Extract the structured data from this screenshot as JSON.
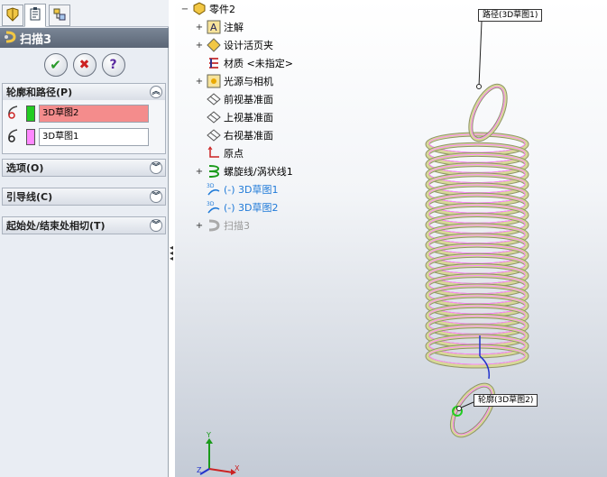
{
  "property_manager": {
    "title": "扫描3",
    "tabs": [
      "feature-manager-icon",
      "property-manager-icon",
      "configuration-manager-icon"
    ],
    "buttons": {
      "ok": "✔",
      "cancel": "✖",
      "help": "?"
    },
    "groups": {
      "profile_path": {
        "label": "轮廓和路径(P)",
        "profile_value": "3D草图2",
        "path_value": "3D草图1",
        "profile_color": "#22cc22",
        "path_color": "#ff88ff"
      },
      "options": {
        "label": "选项(O)"
      },
      "guide_curves": {
        "label": "引导线(C)"
      },
      "start_end_tangency": {
        "label": "起始处/结束处相切(T)"
      }
    }
  },
  "tree": {
    "root": "零件2",
    "items": [
      {
        "label": "注解",
        "expandable": true
      },
      {
        "label": "设计活页夹",
        "expandable": true
      },
      {
        "label": "材质 <未指定>",
        "expandable": false
      },
      {
        "label": "光源与相机",
        "expandable": true
      },
      {
        "label": "前视基准面",
        "expandable": false
      },
      {
        "label": "上视基准面",
        "expandable": false
      },
      {
        "label": "右视基准面",
        "expandable": false
      },
      {
        "label": "原点",
        "expandable": false
      },
      {
        "label": "螺旋线/涡状线1",
        "expandable": true
      },
      {
        "label": "(-) 3D草图1",
        "expandable": false
      },
      {
        "label": "(-) 3D草图2",
        "expandable": false
      },
      {
        "label": "扫描3",
        "expandable": true
      }
    ]
  },
  "viewport": {
    "callout_path": "路径(3D草图1)",
    "callout_profile": "轮廓(3D草图2)",
    "triad_axes": {
      "x": "X",
      "y": "Y",
      "z": "Z"
    },
    "colors": {
      "path": "#ff88ff",
      "profile": "#22cc22",
      "coil": "#d8d898"
    }
  }
}
